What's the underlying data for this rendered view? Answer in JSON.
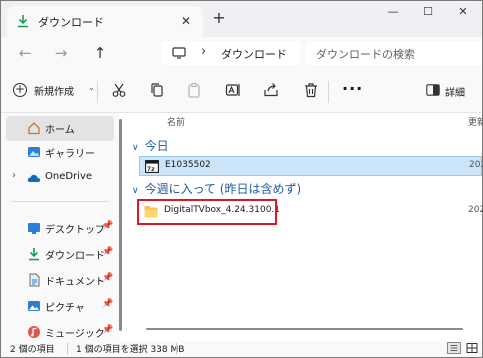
{
  "tab": {
    "title": "ダウンロード",
    "close_glyph": "✕",
    "new_glyph": "+"
  },
  "window_controls": {
    "minimize": "—",
    "maximize": "☐",
    "close": "✕"
  },
  "nav": {
    "back": "←",
    "forward": "→",
    "up": "↑"
  },
  "address": {
    "separator": "›",
    "location": "ダウンロード"
  },
  "search": {
    "placeholder": "ダウンロードの検索"
  },
  "commands": {
    "new_label": "新規作成",
    "new_caret": "⌄",
    "more": "···",
    "details_label": "詳細"
  },
  "sidebar": {
    "items": [
      {
        "label": "ホーム",
        "icon": "home-icon",
        "selected": true
      },
      {
        "label": "ギャラリー",
        "icon": "gallery-icon"
      },
      {
        "label": "OneDrive",
        "icon": "onedrive-icon",
        "expander": "›"
      },
      {
        "label": "デスクトップ",
        "icon": "desktop-folder-icon",
        "pin": "📌"
      },
      {
        "label": "ダウンロード",
        "icon": "download-icon",
        "pin": "📌"
      },
      {
        "label": "ドキュメント",
        "icon": "documents-icon",
        "pin": "📌"
      },
      {
        "label": "ピクチャ",
        "icon": "pictures-icon",
        "pin": "📌"
      },
      {
        "label": "ミュージック",
        "icon": "music-icon",
        "pin": "📌"
      }
    ]
  },
  "content": {
    "column_name": "名前",
    "column_modified": "更新",
    "groups": [
      {
        "title": "今日",
        "caret": "∨",
        "files": [
          {
            "name": "E1035502",
            "date": "202",
            "icon": "zip-icon",
            "selected": true
          }
        ]
      },
      {
        "title": "今週に入って (昨日は含めず)",
        "caret": "∨",
        "files": [
          {
            "name": "DigitalTVbox_4.24.3100.1",
            "date": "202",
            "icon": "folder-icon",
            "selected": false
          }
        ]
      }
    ]
  },
  "status": {
    "item_count": "2 個の項目",
    "selection": "1 個の項目を選択 338 MB"
  },
  "colors": {
    "accent": "#1e5aa8",
    "selection": "#cce4f7",
    "highlight_border": "#d8192a",
    "download_green": "#1a9e5a"
  }
}
